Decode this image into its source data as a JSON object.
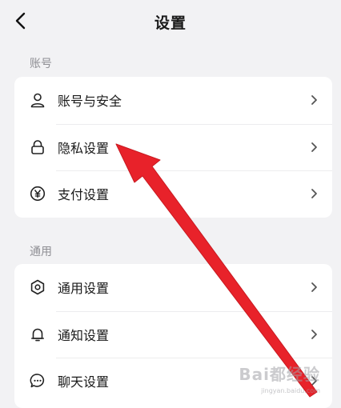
{
  "header": {
    "title": "设置",
    "back_icon": "chevron-left-icon"
  },
  "sections": [
    {
      "label": "账号",
      "items": [
        {
          "label": "账号与安全",
          "icon": "user-icon"
        },
        {
          "label": "隐私设置",
          "icon": "lock-icon"
        },
        {
          "label": "支付设置",
          "icon": "yen-icon"
        }
      ]
    },
    {
      "label": "通用",
      "items": [
        {
          "label": "通用设置",
          "icon": "gear-icon"
        },
        {
          "label": "通知设置",
          "icon": "bell-icon"
        },
        {
          "label": "聊天设置",
          "icon": "chat-icon"
        }
      ]
    }
  ],
  "annotation": {
    "arrow_color": "#e8222a",
    "points_to": "隐私设置"
  },
  "watermark": {
    "text": "Bai都经验",
    "url": "jingyan.baidu.com"
  },
  "colors": {
    "background": "#f2f2f4",
    "card": "#ffffff",
    "section_label": "#8e8e93"
  }
}
